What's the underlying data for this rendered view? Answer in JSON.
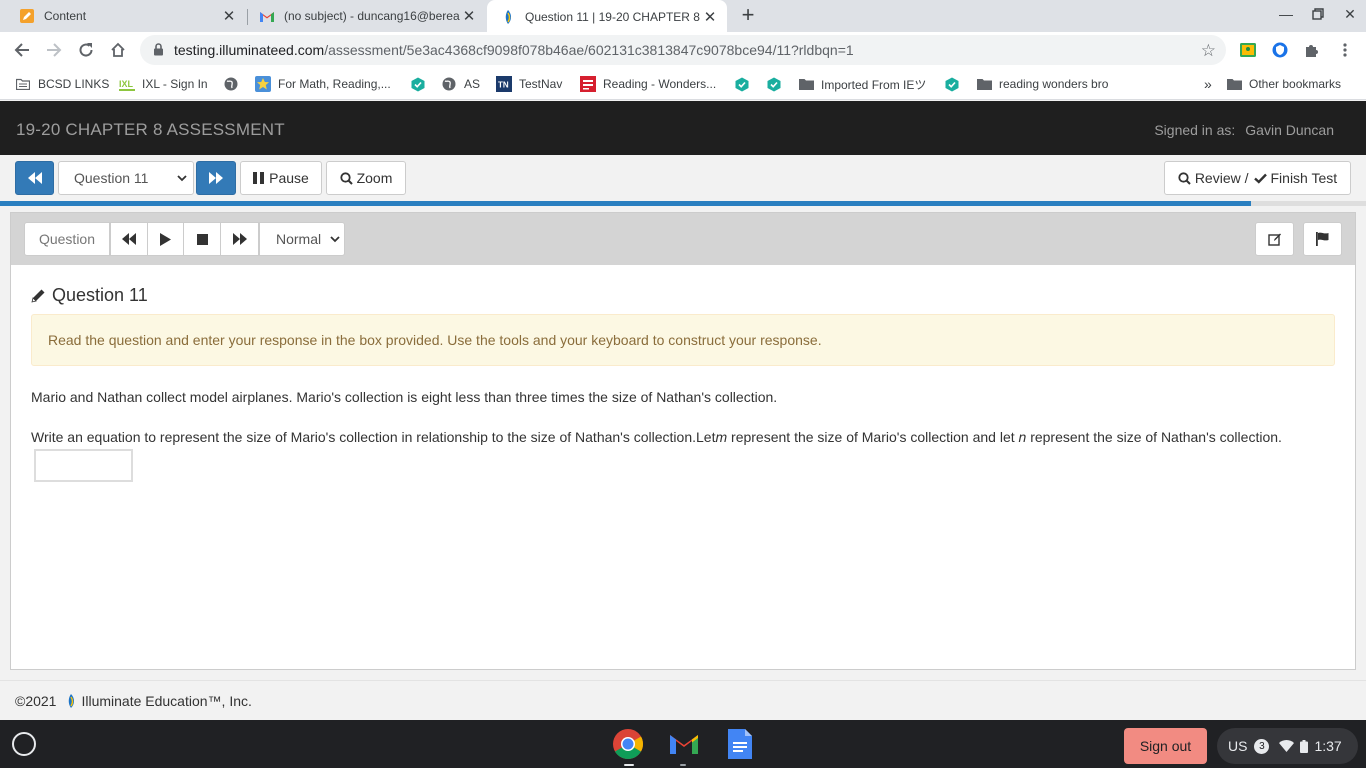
{
  "browser": {
    "tabs": [
      {
        "title": "Content",
        "icon": "pencil-tab-icon",
        "active": false
      },
      {
        "title": "(no subject) - duncang16@berea",
        "icon": "gmail-tab-icon",
        "active": false
      },
      {
        "title": "Question 11 | 19-20 CHAPTER 8",
        "icon": "illuminate-tab-icon",
        "active": true
      }
    ],
    "url_host": "testing.illuminateed.com",
    "url_path": "/assessment/5e3ac4368cf9098f078b46ae/602131c3813847c9078bce94/11?rldbqn=1",
    "bookmarks": [
      {
        "label": "BCSD LINKS",
        "icon": "folder-icon"
      },
      {
        "label": "IXL - Sign In",
        "icon": "ixl-icon"
      },
      {
        "label": "",
        "icon": "globe-icon"
      },
      {
        "label": "For Math, Reading,...",
        "icon": "star-badge-icon"
      },
      {
        "label": "",
        "icon": "hex-check-icon"
      },
      {
        "label": "AS",
        "icon": "globe-icon"
      },
      {
        "label": "TestNav",
        "icon": "testnav-icon"
      },
      {
        "label": "Reading - Wonders...",
        "icon": "mcgraw-icon"
      },
      {
        "label": "",
        "icon": "hex-check-icon"
      },
      {
        "label": "",
        "icon": "hex-check-icon"
      },
      {
        "label": "Imported From IEツ",
        "icon": "folder-icon"
      },
      {
        "label": "",
        "icon": "hex-check-icon"
      },
      {
        "label": "reading wonders bro",
        "icon": "folder-icon"
      }
    ],
    "overflow": "»",
    "other_bookmarks": "Other bookmarks"
  },
  "app": {
    "title": "19-20 CHAPTER 8 ASSESSMENT",
    "signed_in_label": "Signed in as:",
    "user_name": "Gavin Duncan"
  },
  "toolbar": {
    "question_select": "Question 11",
    "pause_label": "Pause",
    "zoom_label": "Zoom",
    "review_label": "Review /",
    "finish_label": "Finish Test",
    "progress_fraction": 0.916
  },
  "question_panel": {
    "question_label": "Question",
    "speed_select": "Normal",
    "heading": "Question 11",
    "instructions": "Read the question and enter your response in the box provided. Use the tools and your keyboard to construct your response.",
    "paragraph1": "Mario and Nathan collect model airplanes. Mario's collection is eight less than three times the size of Nathan's collection.",
    "paragraph2_a": "Write an equation to represent the size of Mario's collection in relationship to the size of Nathan's collection.Let",
    "paragraph2_var_m": "m",
    "paragraph2_b": " represent the size of Mario's collection and let ",
    "paragraph2_var_n": "n",
    "paragraph2_c": " represent the size of Nathan's collection.",
    "response_value": ""
  },
  "footer": {
    "copyright": "©2021",
    "company": "Illuminate Education™, Inc."
  },
  "shelf": {
    "sign_out": "Sign out",
    "keyboard": "US",
    "notifications": "3",
    "time": "1:37"
  },
  "colors": {
    "primary": "#337ab7",
    "header_bg": "#1f1f1f",
    "alert_bg": "#fcf8e3",
    "alert_text": "#8a6d3b",
    "progress": "#2a7fc0",
    "sign_out_bg": "#f28b82"
  }
}
